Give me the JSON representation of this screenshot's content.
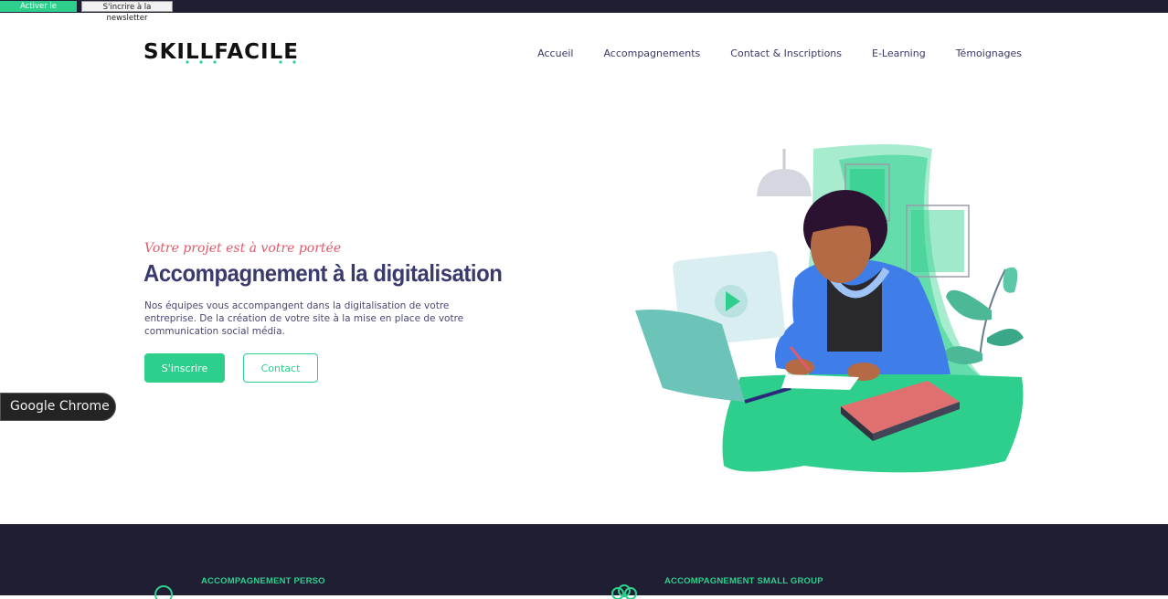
{
  "topbar": {
    "darkmode_label": "Activer le darkmode",
    "newsletter_label": "S'incrire à la newsletter"
  },
  "header": {
    "logo_text": "SKILLFACILE",
    "nav": [
      "Accueil",
      "Accompagnements",
      "Contact & Inscriptions",
      "E-Learning",
      "Témoignages"
    ]
  },
  "hero": {
    "tagline": "Votre projet est à votre portée",
    "title": "Accompagnement à la digitalisation",
    "description": "Nos équipes vous accompangent dans la digitalisation de votre entreprise. De la création de votre site à la mise en place de votre communication social média.",
    "primary_button": "S'inscrire",
    "secondary_button": "Contact"
  },
  "overlay": {
    "chrome_label": "Google Chrome"
  },
  "features": {
    "items": [
      "ACCOMPAGNEMENT PERSO",
      "ACCOMPAGNEMENT SMALL GROUP"
    ]
  },
  "colors": {
    "accent": "#2ecf8c",
    "navy": "#1f1e33",
    "title": "#3a3a6e",
    "tagline": "#e05a6b"
  },
  "icons": [
    "person-icon",
    "group-icon"
  ]
}
